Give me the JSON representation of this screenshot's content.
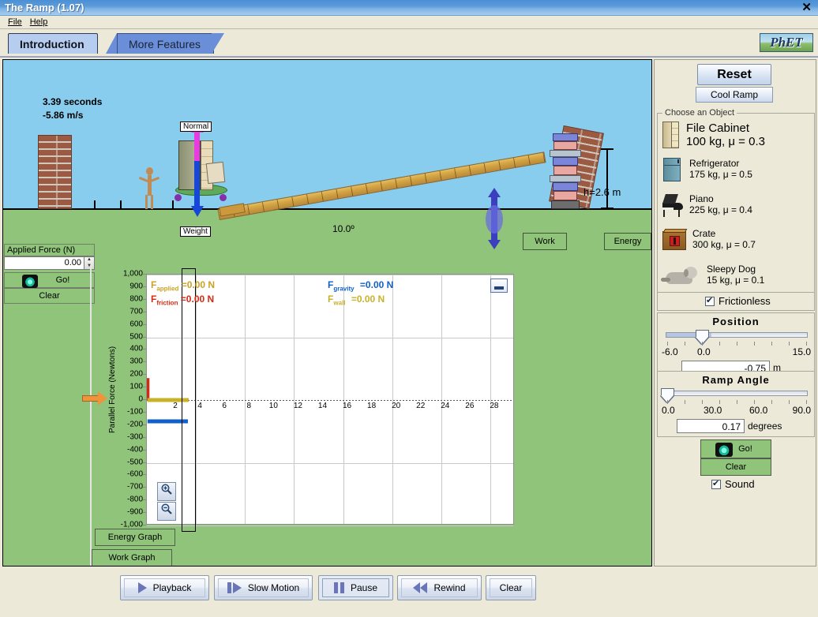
{
  "window": {
    "title": "The Ramp (1.07)",
    "close_label": "✕"
  },
  "menu": {
    "items": [
      {
        "label": "File"
      },
      {
        "label": "Help"
      }
    ]
  },
  "tabs": [
    {
      "label": "Introduction",
      "active": true
    },
    {
      "label": "More Features",
      "active": false
    }
  ],
  "logo": {
    "text": "PhET"
  },
  "simulation": {
    "time_readout": "3.39 seconds",
    "velocity_readout": "-5.86 m/s",
    "normal_label": "Normal",
    "weight_label": "Weight",
    "height_label": "h=2.6 m",
    "angle_label": "10.0º",
    "work_button": "Work",
    "energy_button": "Energy"
  },
  "applied_force": {
    "title": "Applied Force (N)",
    "value": "0.00",
    "go_label": "Go!",
    "clear_label": "Clear"
  },
  "chart_data": {
    "type": "line",
    "title": "",
    "xlabel": "",
    "ylabel": "Parallel Force (Newtons)",
    "xlim": [
      0,
      30
    ],
    "ylim": [
      -1000,
      1000
    ],
    "xticks": [
      2,
      4,
      6,
      8,
      10,
      12,
      14,
      16,
      18,
      20,
      22,
      24,
      26,
      28
    ],
    "yticks": [
      "1,000",
      "900",
      "800",
      "700",
      "600",
      "500",
      "400",
      "300",
      "200",
      "100",
      "0",
      "-100",
      "-200",
      "-300",
      "-400",
      "-500",
      "-600",
      "-700",
      "-800",
      "-900",
      "-1,000"
    ],
    "grid": true,
    "legend_position": "inside-top",
    "series": [
      {
        "name": "F_applied",
        "label_html": "F<sub>applied</sub>",
        "value_text": "=0.00 N",
        "color": "#c8a224",
        "x": [
          0.05,
          3.4
        ],
        "y": [
          0,
          0
        ]
      },
      {
        "name": "F_friction",
        "label_html": "F<sub>friction</sub>",
        "value_text": "=0.00 N",
        "color": "#d42a14",
        "x": [
          0.05,
          0.05
        ],
        "y": [
          175,
          0
        ]
      },
      {
        "name": "F_gravity",
        "label_html": "F<sub>gravity</sub>",
        "value_text": "=0.00 N",
        "color": "#1160c8",
        "x": [
          0.05,
          3.35
        ],
        "y": [
          -170,
          -170
        ]
      },
      {
        "name": "F_wall",
        "label_html": "F<sub>wall</sub>",
        "value_text": "=0.00 N",
        "color": "#c8b22a",
        "x": [
          0.05,
          3.4
        ],
        "y": [
          0,
          0
        ]
      }
    ],
    "cursor_x": 3.4
  },
  "graph_controls": {
    "minimize_label": "",
    "zoom_in_label": "🔍",
    "zoom_out_label": "🔍",
    "energy_graph_button": "Energy Graph",
    "work_graph_button": "Work Graph"
  },
  "right_panel": {
    "reset_label": "Reset",
    "cool_ramp_label": "Cool Ramp",
    "choose_object_title": "Choose an Object",
    "objects": [
      {
        "name": "File Cabinet",
        "spec": "100 kg, μ = 0.3",
        "icon": "file-cabinet-icon",
        "selected": true
      },
      {
        "name": "Refrigerator",
        "spec": "175 kg, μ = 0.5",
        "icon": "refrigerator-icon",
        "selected": false
      },
      {
        "name": "Piano",
        "spec": "225 kg, μ = 0.4",
        "icon": "piano-icon",
        "selected": false
      },
      {
        "name": "Crate",
        "spec": "300 kg, μ = 0.7",
        "icon": "crate-icon",
        "selected": false
      },
      {
        "name": "Sleepy Dog",
        "spec": "15 kg, μ = 0.1",
        "icon": "dog-icon",
        "selected": false
      }
    ],
    "frictionless": {
      "label": "Frictionless",
      "checked": true
    },
    "position": {
      "title": "Position",
      "min_label": "-6.0",
      "mid_label": "0.0",
      "max_label": "15.0",
      "value": "-0.75",
      "unit": "m"
    },
    "ramp_angle": {
      "title": "Ramp Angle",
      "min_label": "0.0",
      "mid1_label": "30.0",
      "mid2_label": "60.0",
      "max_label": "90.0",
      "value": "0.17",
      "unit": "degrees"
    },
    "go_label": "Go!",
    "clear_label": "Clear",
    "sound": {
      "label": "Sound",
      "checked": true
    }
  },
  "playback": {
    "buttons": [
      {
        "label": "Playback",
        "icon": "play-icon"
      },
      {
        "label": "Slow Motion",
        "icon": "slow-motion-icon"
      },
      {
        "label": "Pause",
        "icon": "pause-icon"
      },
      {
        "label": "Rewind",
        "icon": "rewind-icon"
      },
      {
        "label": "Clear",
        "icon": ""
      }
    ]
  }
}
